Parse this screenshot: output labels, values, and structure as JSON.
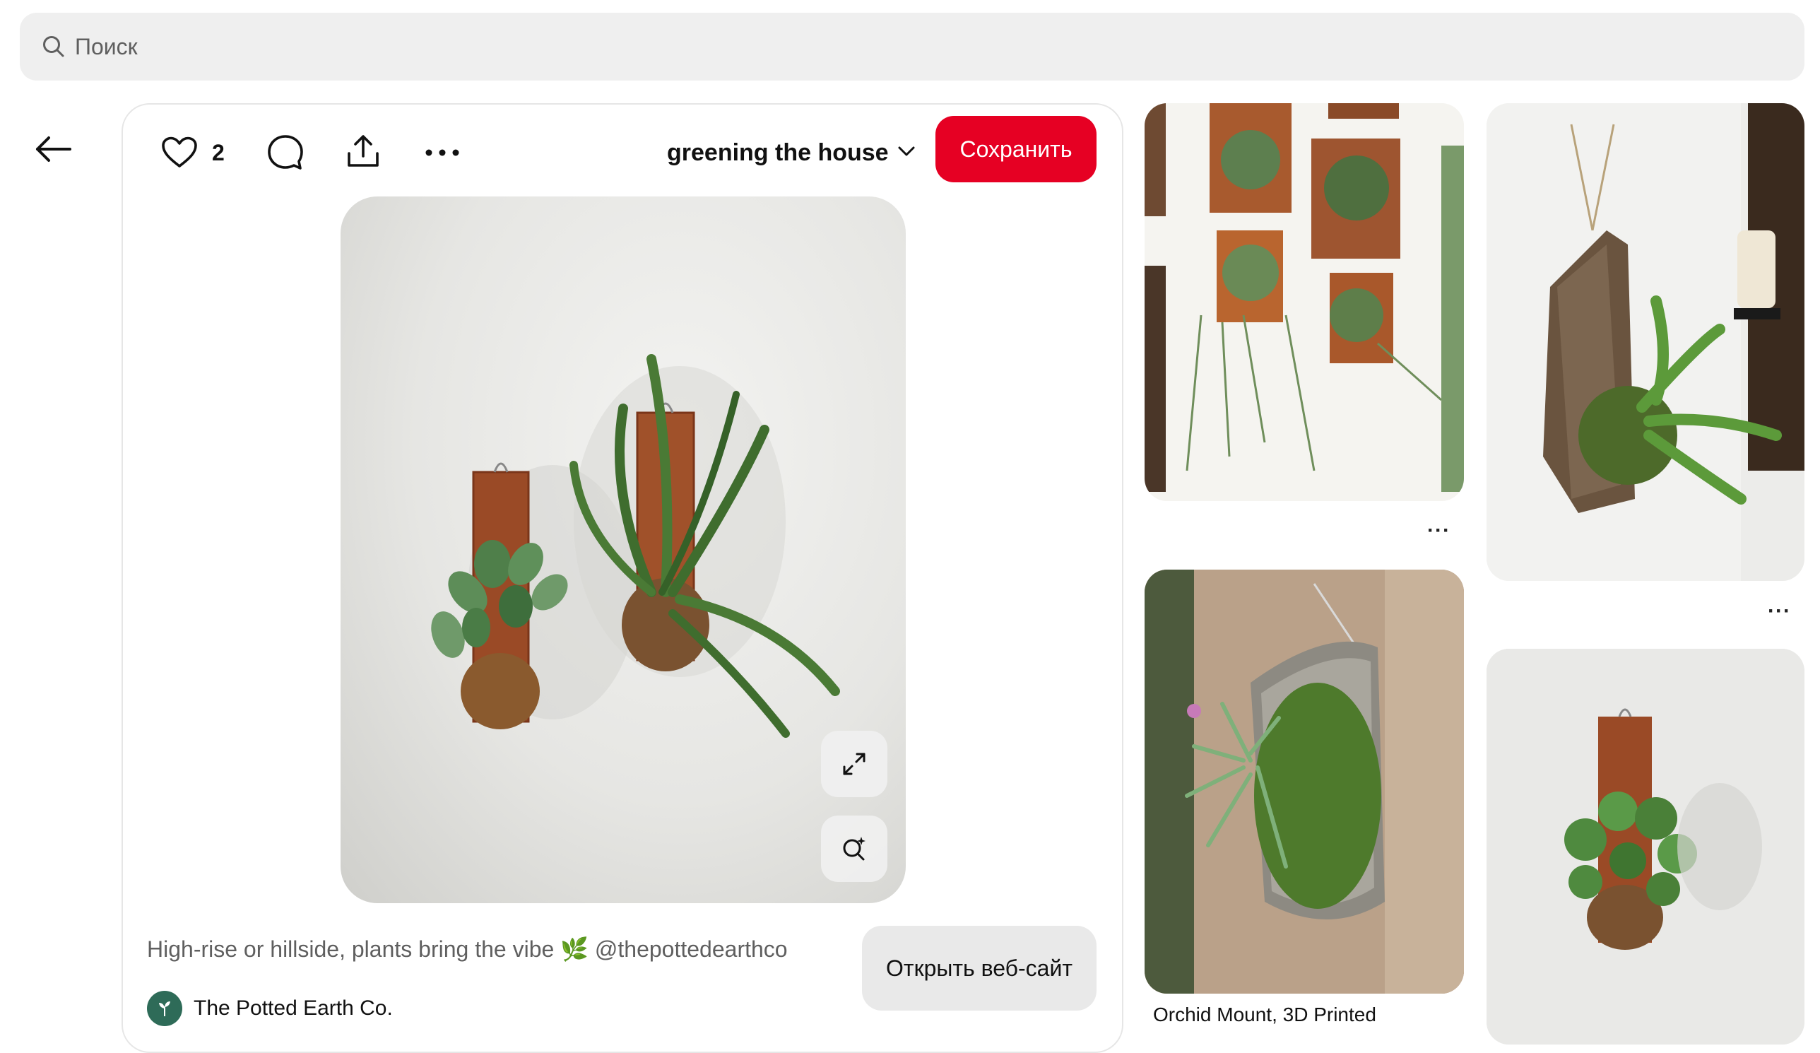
{
  "search": {
    "placeholder": "Поиск"
  },
  "pin": {
    "like_count": "2",
    "board_name": "greening the house",
    "save_label": "Сохранить",
    "description": "High-rise or hillside, plants bring the vibe 🌿 @thepottedearthco",
    "open_site_label": "Открыть веб-сайт",
    "author_name": "The Potted Earth Co."
  },
  "related": [
    {
      "title": "",
      "more": "···"
    },
    {
      "title": "",
      "more": "···"
    },
    {
      "title": "Orchid Mount, 3D Printed",
      "more": ""
    },
    {
      "title": "",
      "more": ""
    }
  ],
  "colors": {
    "save": "#e60023",
    "search_bg": "#efefef"
  },
  "icons": [
    "search-icon",
    "back-arrow-icon",
    "heart-icon",
    "comment-icon",
    "share-icon",
    "more-icon",
    "chevron-down-icon",
    "expand-icon",
    "visual-search-icon"
  ]
}
